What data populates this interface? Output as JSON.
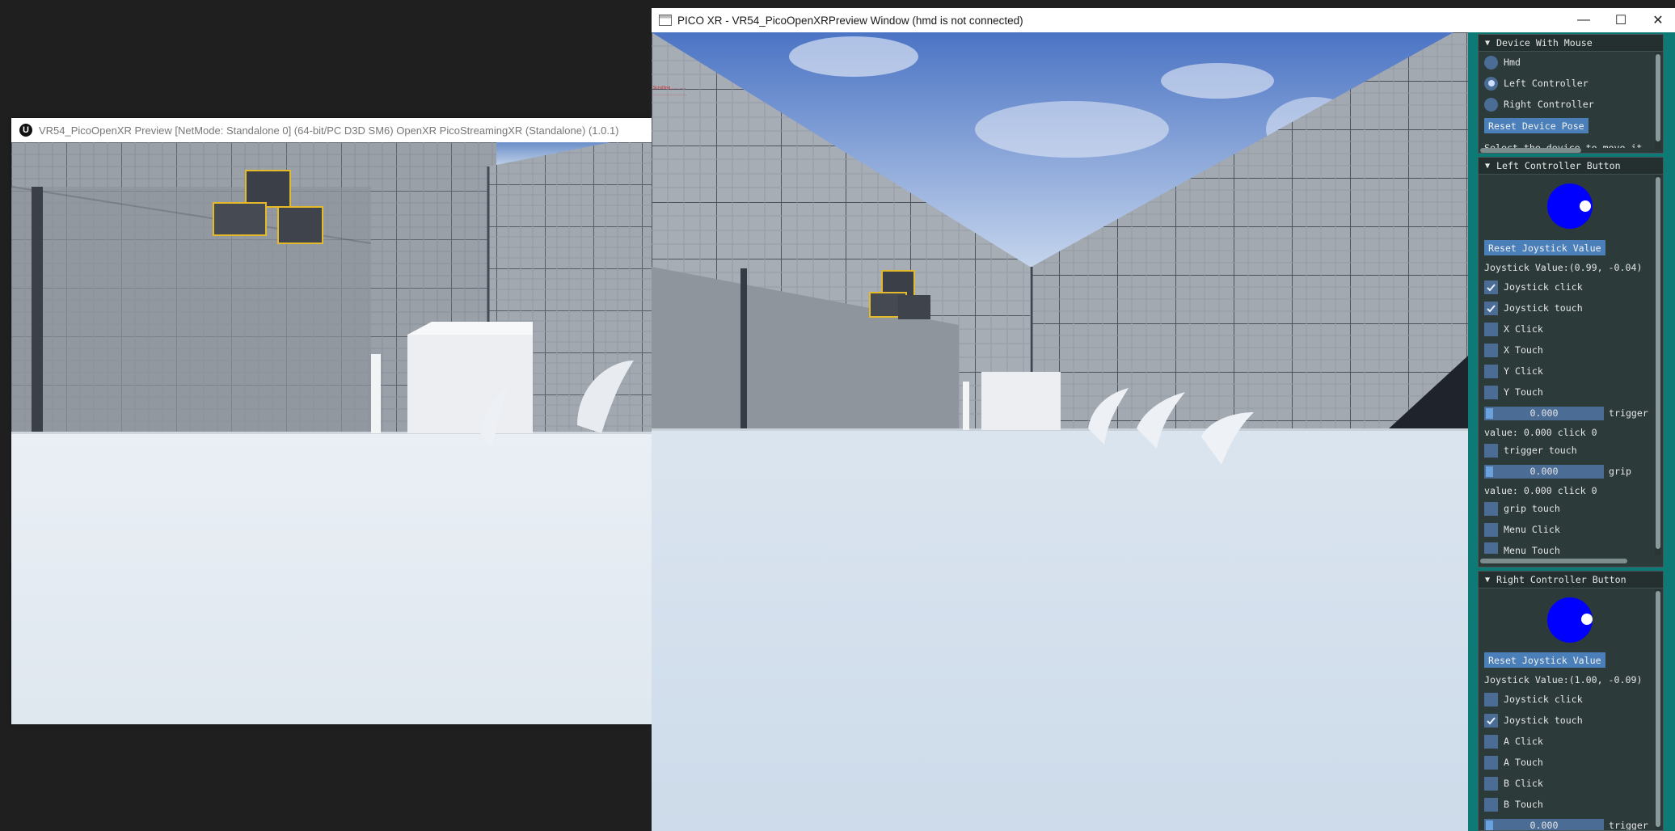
{
  "ue_preview": {
    "title": "VR54_PicoOpenXR Preview [NetMode: Standalone 0]  (64-bit/PC D3D SM6) OpenXR  PicoStreamingXR (Standalone) (1.0.1)",
    "logo_letter": "U"
  },
  "pico_window": {
    "title": "PICO XR - VR54_PicoOpenXRPreview Window (hmd is not connected)",
    "minimize": "—",
    "maximize": "☐",
    "close": "✕"
  },
  "device_panel": {
    "title": "Device With Mouse",
    "options": [
      "Hmd",
      "Left Controller",
      "Right Controller"
    ],
    "selected": "Left Controller",
    "reset_label": "Reset Device Pose",
    "hint": "Select the device to move it"
  },
  "left_controller": {
    "title": "Left Controller Button",
    "reset_label": "Reset Joystick Value",
    "joystick_value": "Joystick Value:(0.99, -0.04)",
    "checks": [
      {
        "label": "Joystick click",
        "checked": true
      },
      {
        "label": "Joystick touch",
        "checked": true
      },
      {
        "label": "X Click",
        "checked": false
      },
      {
        "label": "X Touch",
        "checked": false
      },
      {
        "label": "Y Click",
        "checked": false
      },
      {
        "label": "Y Touch",
        "checked": false
      }
    ],
    "trigger": {
      "value": "0.000",
      "label": "trigger",
      "status": "value: 0.000 click 0",
      "touch": "trigger touch"
    },
    "grip": {
      "value": "0.000",
      "label": "grip",
      "status": "value: 0.000 click 0",
      "touch": "grip touch"
    },
    "menu_click": "Menu Click",
    "menu_touch": "Menu Touch"
  },
  "right_controller": {
    "title": "Right Controller Button",
    "reset_label": "Reset Joystick Value",
    "joystick_value": "Joystick Value:(1.00, -0.09)",
    "checks": [
      {
        "label": "Joystick click",
        "checked": false
      },
      {
        "label": "Joystick touch",
        "checked": true
      },
      {
        "label": "A Click",
        "checked": false
      },
      {
        "label": "A Touch",
        "checked": false
      },
      {
        "label": "B Click",
        "checked": false
      },
      {
        "label": "B Touch",
        "checked": false
      }
    ],
    "trigger": {
      "value": "0.000",
      "label": "trigger"
    }
  },
  "colors": {
    "panel_bg": "#2c3a3a",
    "side_bg": "#0e7a76",
    "accent": "#4a7fba",
    "joystick": "#0000ff"
  }
}
